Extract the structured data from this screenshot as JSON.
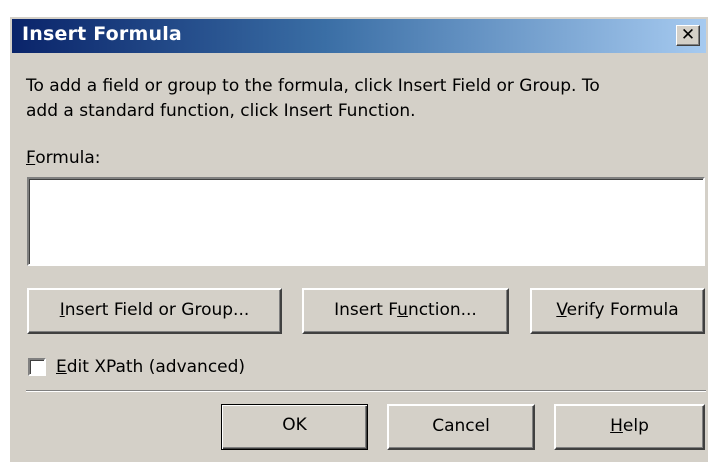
{
  "window": {
    "title": "Insert Formula",
    "close_symbol": "✕",
    "close_icon": "close-icon"
  },
  "instructions": {
    "line1": "To add a field or group to the formula, click Insert Field or Group. To",
    "line2": "add a standard function, click Insert Function."
  },
  "formula": {
    "label_mnemonic": "F",
    "label_rest": "ormula:",
    "value": ""
  },
  "buttons": {
    "insert_field": {
      "pre": "",
      "mnemonic": "I",
      "post": "nsert Field or Group..."
    },
    "insert_function": {
      "pre": "Insert F",
      "mnemonic": "u",
      "post": "nction..."
    },
    "verify_formula": {
      "pre": "",
      "mnemonic": "V",
      "post": "erify Formula"
    }
  },
  "edit_xpath": {
    "checked": false,
    "label_mnemonic": "E",
    "label_rest": "dit XPath (advanced)"
  },
  "footer": {
    "ok_label": "OK",
    "cancel_label": "Cancel",
    "help_mnemonic": "H",
    "help_rest": "elp"
  },
  "colors": {
    "dialog_background": "#d4d0c8",
    "titlebar_start": "#0a246a",
    "titlebar_end": "#a6caf0",
    "title_text": "#ffffff"
  }
}
